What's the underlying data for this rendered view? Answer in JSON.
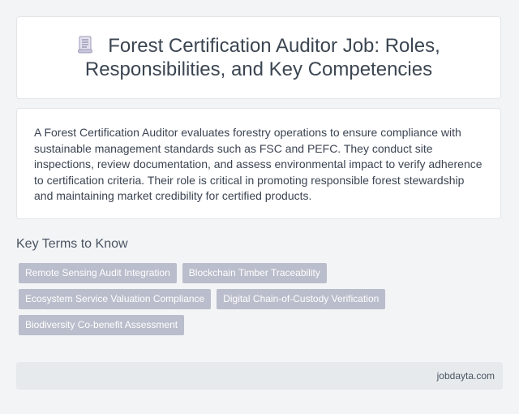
{
  "header": {
    "icon": "document-icon",
    "title": "Forest Certification Auditor Job: Roles, Responsibilities, and Key Competencies"
  },
  "summary": {
    "text": "A Forest Certification Auditor evaluates forestry operations to ensure compliance with sustainable management standards such as FSC and PEFC. They conduct site inspections, review documentation, and assess environmental impact to verify adherence to certification criteria. Their role is critical in promoting responsible forest stewardship and maintaining market credibility for certified products."
  },
  "key_terms": {
    "heading": "Key Terms to Know",
    "rows": [
      [
        "Remote Sensing Audit Integration",
        "Blockchain Timber Traceability"
      ],
      [
        "Ecosystem Service Valuation Compliance",
        "Digital Chain-of-Custody Verification"
      ],
      [
        "Biodiversity Co-benefit Assessment"
      ]
    ]
  },
  "footer": {
    "site": "jobdayta.com"
  },
  "colors": {
    "background": "#f3f4f6",
    "card": "#ffffff",
    "tag": "#babdcb",
    "footer": "#e6eaec"
  }
}
